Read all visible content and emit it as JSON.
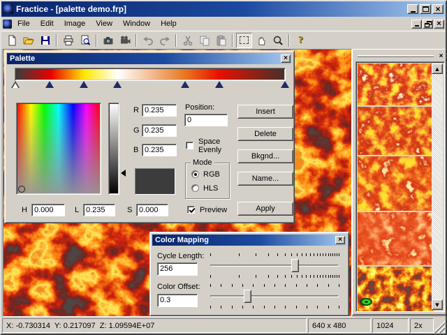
{
  "window": {
    "title": "Fractice - [palette demo.frp]"
  },
  "menu": {
    "items": [
      "File",
      "Edit",
      "Image",
      "View",
      "Window",
      "Help"
    ]
  },
  "toolbar": {
    "buttons": [
      "new",
      "open",
      "save",
      "print",
      "print-preview",
      "snapshot",
      "record",
      "undo",
      "redo",
      "cut",
      "copy",
      "paste",
      "select",
      "pan",
      "zoom",
      "help"
    ]
  },
  "palette": {
    "title": "Palette",
    "gradient_stops": [
      {
        "pos": 0.0,
        "color": "#3c3c3c"
      },
      {
        "pos": 0.13,
        "color": "#e80000"
      },
      {
        "pos": 0.255,
        "color": "#ffe800"
      },
      {
        "pos": 0.38,
        "color": "#ffffff"
      },
      {
        "pos": 0.63,
        "color": "#e87820"
      },
      {
        "pos": 0.755,
        "color": "#e81000"
      },
      {
        "pos": 1.0,
        "color": "#483028"
      }
    ],
    "markers": [
      0.003,
      0.13,
      0.255,
      0.38,
      0.63,
      0.755,
      0.997
    ],
    "selected_marker": 0,
    "rgb": {
      "r_label": "R",
      "g_label": "G",
      "b_label": "B",
      "r": "0.235",
      "g": "0.235",
      "b": "0.235"
    },
    "hls": {
      "h_label": "H",
      "l_label": "L",
      "s_label": "S",
      "h": "0.000",
      "l": "0.235",
      "s": "0.000"
    },
    "position_label": "Position:",
    "position_value": "0",
    "space_evenly_line1": "Space",
    "space_evenly_line2": "Evenly",
    "space_evenly_checked": false,
    "mode": {
      "label": "Mode",
      "rgb": "RGB",
      "hls": "HLS",
      "selected": "RGB"
    },
    "preview_label": "Preview",
    "preview_checked": true,
    "buttons": {
      "insert": "Insert",
      "delete": "Delete",
      "bkgnd": "Bkgnd...",
      "name": "Name...",
      "apply": "Apply"
    },
    "swatch_color": "#3c3c3c",
    "luminance_marker": 0.765
  },
  "color_mapping": {
    "title": "Color Mapping",
    "cycle_length_label": "Cycle Length:",
    "cycle_length_value": "256",
    "cycle_length_slider_pos": 0.66,
    "color_offset_label": "Color Offset:",
    "color_offset_value": "0.3",
    "color_offset_slider_pos": 0.29
  },
  "status_bar": {
    "coordinates": "X: -0.730314  Y: 0.217097  Z: 1.09594E+07",
    "image_size": "640 x 480",
    "iterations": "1024",
    "zoom": "2x"
  },
  "colors": {
    "titlebar_start": "#0a246a",
    "titlebar_end": "#a6caf0",
    "chrome": "#d4d0c8"
  }
}
